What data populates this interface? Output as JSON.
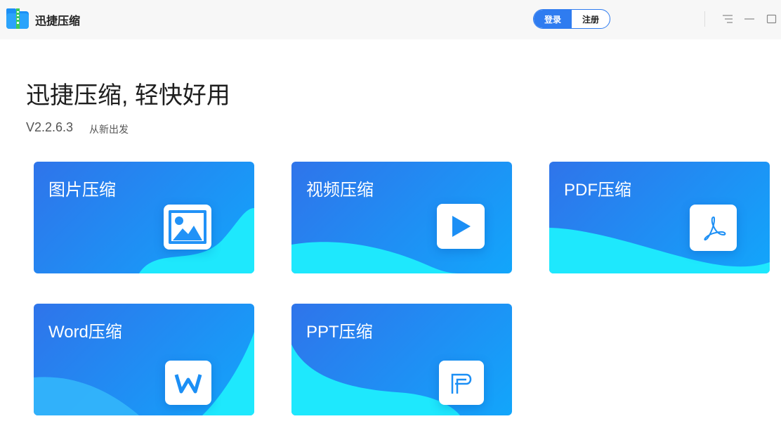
{
  "app": {
    "title": "迅捷压缩"
  },
  "auth": {
    "login": "登录",
    "register": "注册"
  },
  "hero": {
    "heading": "迅捷压缩, 轻快好用",
    "version": "V2.2.6.3",
    "tagline": "从新出发"
  },
  "cards": [
    {
      "label": "图片压缩",
      "icon": "image-icon"
    },
    {
      "label": "视频压缩",
      "icon": "play-icon"
    },
    {
      "label": "PDF压缩",
      "icon": "pdf-icon"
    },
    {
      "label": "Word压缩",
      "icon": "word-icon"
    },
    {
      "label": "PPT压缩",
      "icon": "ppt-icon"
    }
  ],
  "colors": {
    "accent": "#2f7cf0",
    "card_gradient_start": "#2f74ea",
    "card_gradient_end": "#12a6fb",
    "wave": "#1ee8fd"
  }
}
